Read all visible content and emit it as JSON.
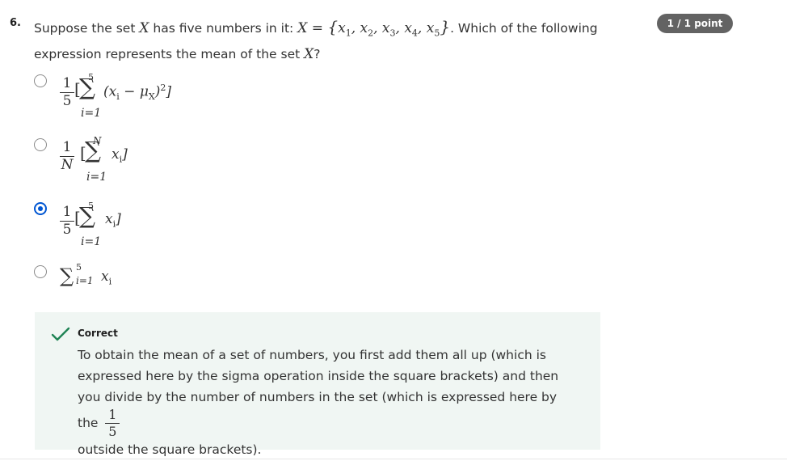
{
  "question": {
    "number": "6.",
    "text_a": "Suppose the set ",
    "set_var": "X",
    "text_b": " has five numbers in it: ",
    "set_def": "X = {x₁, x₂, x₃, x₄, x₅}",
    "text_c": ". Which of the following expression represents the mean of the set ",
    "text_d": "?"
  },
  "points_badge": "1 / 1 point",
  "options": [
    {
      "selected": false,
      "frac_num": "1",
      "frac_den": "5",
      "sum_top": "5",
      "sum_bottom": "i=1",
      "body": "(x_i − μ_X)^2]"
    },
    {
      "selected": false,
      "frac_num": "1",
      "frac_den": "N",
      "sum_top": "N",
      "sum_bottom": "i=1",
      "body": "x_i]"
    },
    {
      "selected": true,
      "frac_num": "1",
      "frac_den": "5",
      "sum_top": "5",
      "sum_bottom": "i=1",
      "body": "x_i]"
    },
    {
      "selected": false,
      "sum_top": "5",
      "sum_bottom": "i=1",
      "body": "x_i"
    }
  ],
  "feedback": {
    "status": "Correct",
    "status_color": "#1f8354",
    "text_1": "To obtain the mean of a set of numbers, you first add them all up (which is expressed here by the sigma operation inside the square brackets) and then you divide by the number of numbers in the set (which is expressed here by the",
    "frac_num": "1",
    "frac_den": "5",
    "text_2": "outside the square brackets)."
  },
  "colors": {
    "accent": "#0056d2",
    "badge_bg": "#636363",
    "feedback_bg": "#f0f6f3"
  }
}
